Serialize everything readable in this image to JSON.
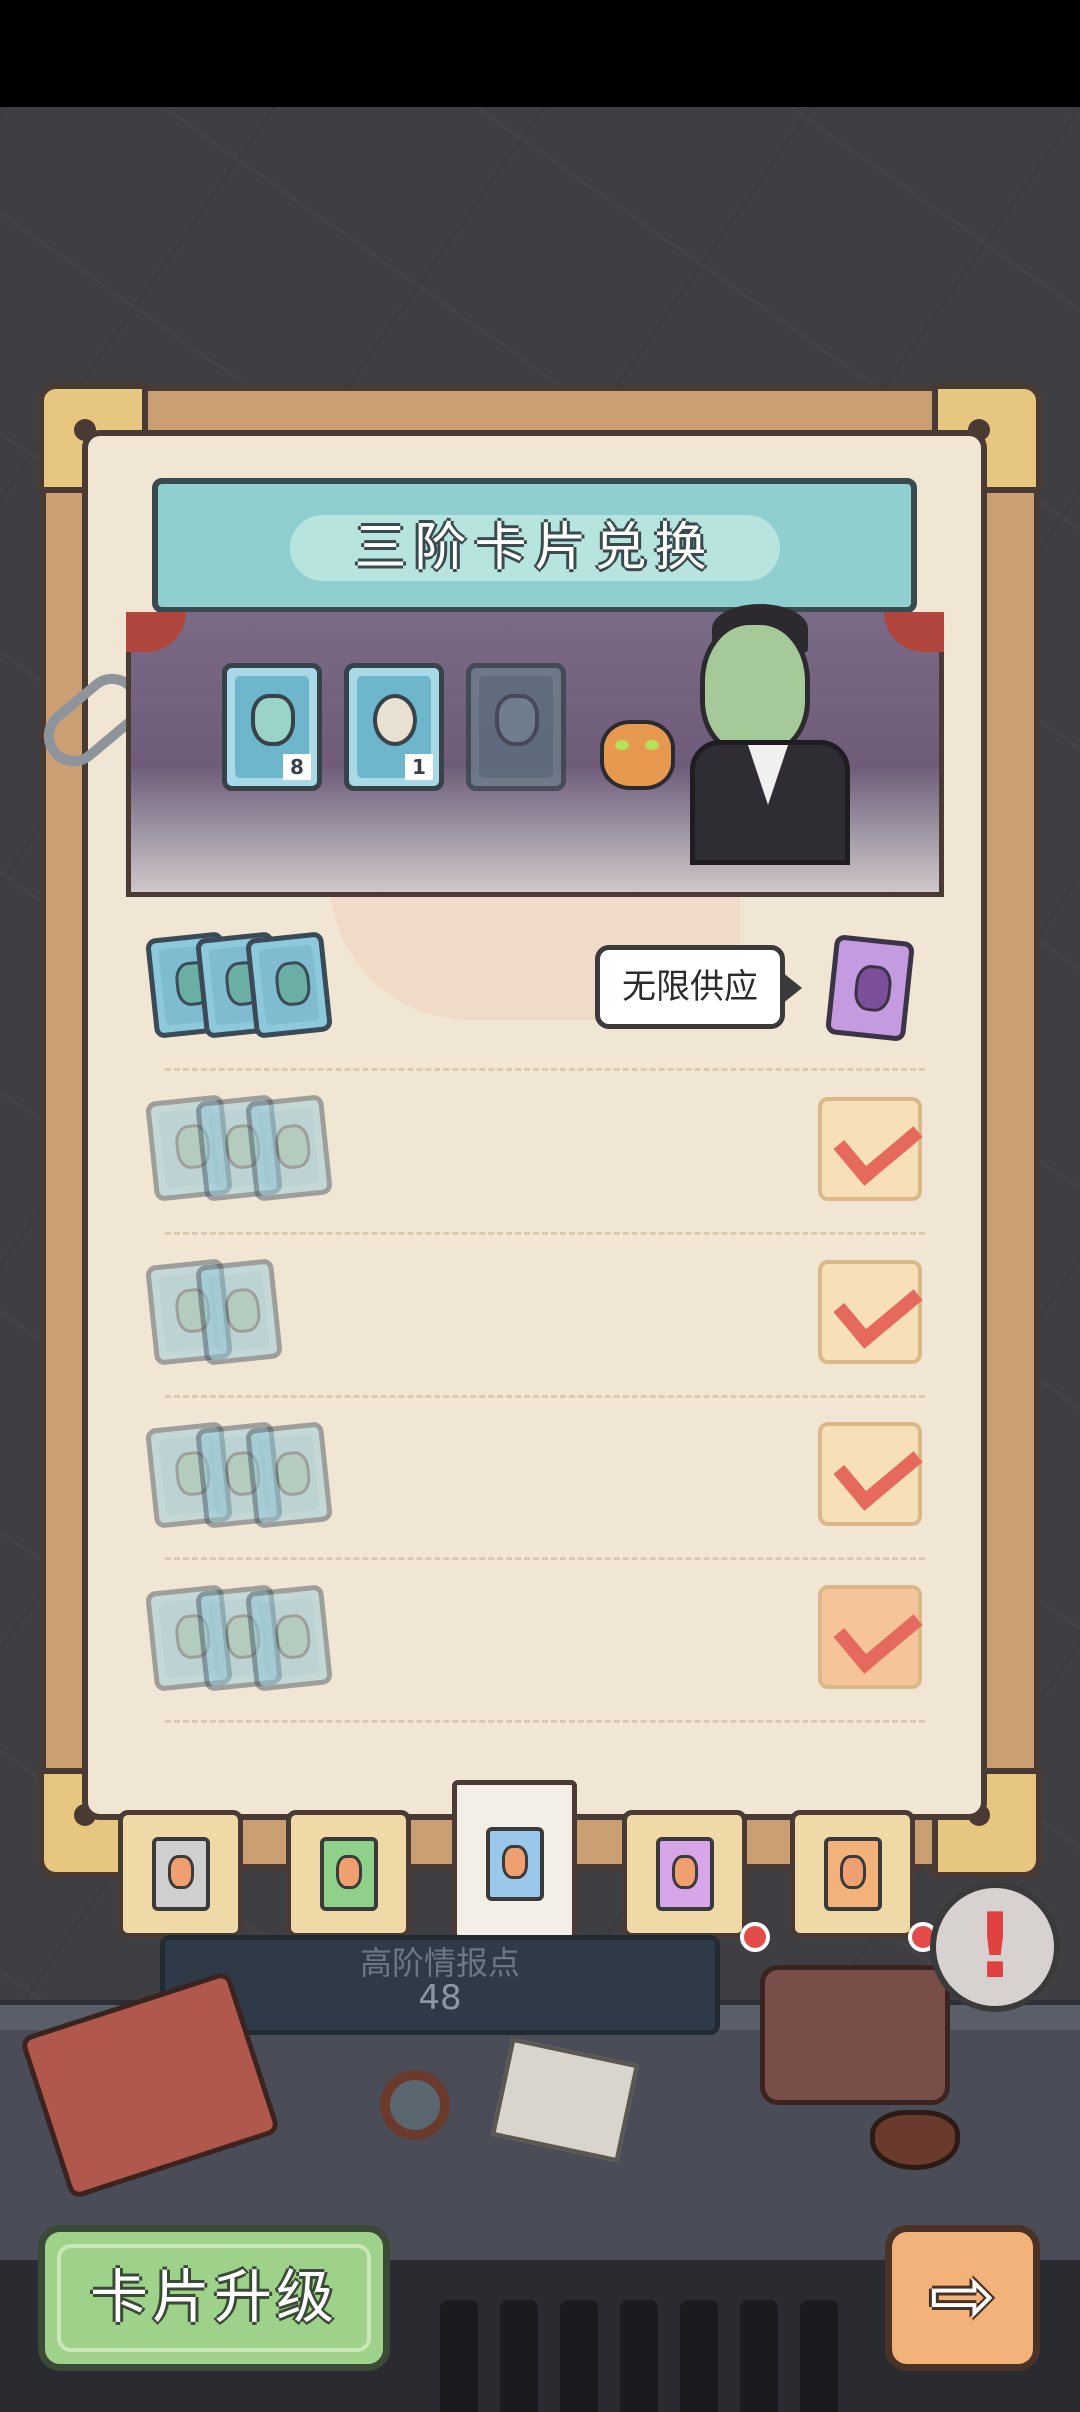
{
  "header": {
    "title": "三阶卡片兑换"
  },
  "scene": {
    "mini_cards": [
      {
        "icon": "jar-card-icon",
        "count": "8"
      },
      {
        "icon": "tiger-card-icon",
        "count": "1"
      },
      {
        "icon": "locked-card-icon",
        "count": ""
      }
    ]
  },
  "rows": [
    {
      "cards": 3,
      "reward": "purple-jar-card-icon",
      "badge": "无限供应",
      "status": "available"
    },
    {
      "cards": 3,
      "reward": "check-icon",
      "status": "claimed"
    },
    {
      "cards": 2,
      "reward": "check-icon",
      "status": "claimed"
    },
    {
      "cards": 3,
      "reward": "check-icon",
      "status": "claimed"
    },
    {
      "cards": 3,
      "reward": "check-icon",
      "status": "claimed"
    }
  ],
  "tabs": [
    {
      "name": "tab-gray",
      "color": "#cfcfcf"
    },
    {
      "name": "tab-green",
      "color": "#8fd08a"
    },
    {
      "name": "tab-blue",
      "color": "#9ac8ea",
      "active": true
    },
    {
      "name": "tab-purple",
      "color": "#d7a6e8"
    },
    {
      "name": "tab-orange",
      "color": "#f3b27a"
    }
  ],
  "intel": {
    "title": "高阶情报点",
    "value": "48"
  },
  "footer": {
    "upgrade_label": "卡片升级",
    "next_label": "⇨"
  },
  "colors": {
    "accent": "#8fcfcf",
    "paper": "#f1e6d4",
    "frame": "#c99f73"
  }
}
